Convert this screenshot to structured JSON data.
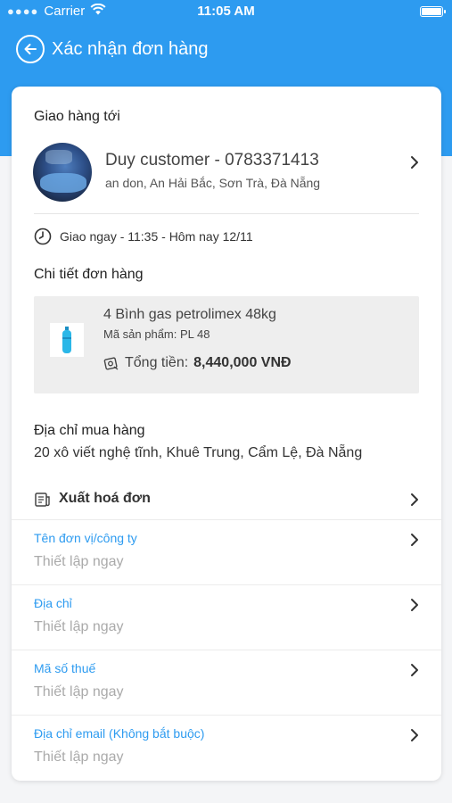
{
  "status_bar": {
    "carrier": "Carrier",
    "time": "11:05 AM"
  },
  "header": {
    "title": "Xác nhận đơn hàng"
  },
  "delivery": {
    "section_title": "Giao hàng tới",
    "customer_name": "Duy customer - 0783371413",
    "customer_address": "an don, An Hải Bắc, Sơn Trà, Đà Nẵng",
    "time_text": "Giao ngay - 11:35 - Hôm nay 12/11"
  },
  "order_detail": {
    "section_title": "Chi tiết đơn hàng",
    "product_name": "4 Bình gas petrolimex 48kg",
    "product_code": "Mã sản phẩm: PL 48",
    "total_label": "Tổng tiền:",
    "total_value": "8,440,000 VNĐ"
  },
  "purchase_address": {
    "title": "Địa chỉ mua hàng",
    "value": "20 xô viết nghệ tĩnh, Khuê Trung, Cẩm Lệ, Đà Nẵng"
  },
  "invoice": {
    "title": "Xuất hoá đơn",
    "fields": [
      {
        "label": "Tên đơn vị/công ty",
        "value": "Thiết lập ngay"
      },
      {
        "label": "Địa chỉ",
        "value": "Thiết lập ngay"
      },
      {
        "label": "Mã số thuế",
        "value": "Thiết lập ngay"
      },
      {
        "label": "Địa chỉ email (Không bắt buộc)",
        "value": "Thiết lập ngay"
      }
    ]
  },
  "icons": [
    "wifi-icon",
    "battery-icon",
    "back-arrow-icon",
    "chevron-right-icon",
    "clock-icon",
    "gas-cylinder-icon",
    "money-icon",
    "receipt-icon"
  ],
  "colors": {
    "primary": "#2d9bf0",
    "card_bg": "#ffffff",
    "product_bg": "#eeeeee",
    "placeholder": "#aaaaaa"
  }
}
